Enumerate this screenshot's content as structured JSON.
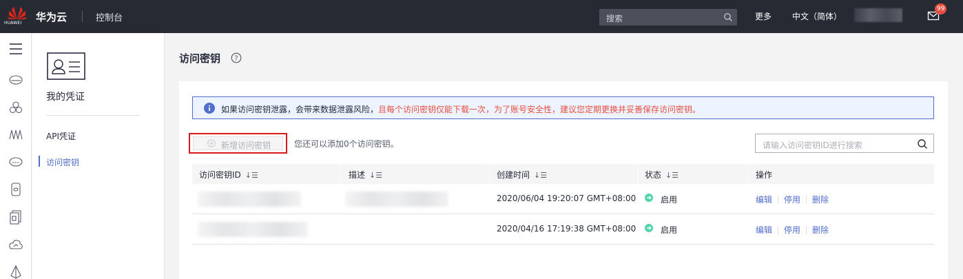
{
  "topbar": {
    "logo_text": "HUAWEI",
    "brand": "华为云",
    "console": "控制台",
    "search_placeholder": "搜索",
    "more": "更多",
    "language": "中文（简体）",
    "mail_badge": "99"
  },
  "subnav": {
    "title": "我的凭证",
    "items": [
      {
        "label": "API凭证"
      },
      {
        "label": "访问密钥"
      }
    ]
  },
  "main": {
    "title": "访问密钥",
    "notice_normal": "如果访问密钥泄露，会带来数据泄露风险，",
    "notice_warning": "且每个访问密钥仅能下载一次，为了账号安全性，建议您定期更换并妥善保存访问密钥。",
    "add_button": "新增访问密钥",
    "remaining": "您还可以添加0个访问密钥。",
    "search_placeholder": "请输入访问密钥ID进行搜索",
    "columns": [
      "访问密钥ID",
      "描述",
      "创建时间",
      "状态",
      "操作"
    ],
    "rows": [
      {
        "created": "2020/06/04 19:20:07 GMT+08:00",
        "status": "启用"
      },
      {
        "created": "2020/04/16 17:19:38 GMT+08:00",
        "status": "启用"
      }
    ],
    "actions": {
      "edit": "编辑",
      "disable": "停用",
      "delete": "删除"
    }
  },
  "colors": {
    "topbar": "#262a33",
    "accent": "#526ecc",
    "warning": "#e84e40",
    "status_ok": "#50d4ab",
    "highlight_box": "#d7191b"
  }
}
